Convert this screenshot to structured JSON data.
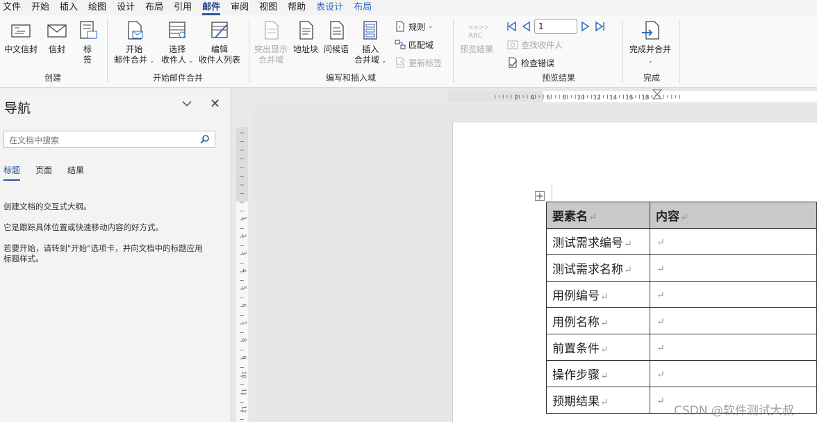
{
  "menu": {
    "items": [
      "文件",
      "开始",
      "插入",
      "绘图",
      "设计",
      "布局",
      "引用",
      "邮件",
      "审阅",
      "视图",
      "帮助",
      "表设计",
      "布局"
    ],
    "active_index": 7,
    "contextual_indices": [
      11,
      12
    ]
  },
  "ribbon": {
    "create_group": {
      "title": "创建",
      "envelopes": "中文信封",
      "envelope": "信封",
      "labels_line1": "标",
      "labels_line2": "签"
    },
    "start_merge_group": {
      "title": "开始邮件合并",
      "start_line1": "开始",
      "start_line2": "邮件合并",
      "select_line1": "选择",
      "select_line2": "收件人",
      "edit_line1": "编辑",
      "edit_line2": "收件人列表"
    },
    "write_insert_group": {
      "title": "编写和插入域",
      "highlight_line1": "突出显示",
      "highlight_line2": "合并域",
      "address_block": "地址块",
      "greeting_line": "问候语",
      "insert_line1": "插入",
      "insert_line2": "合并域",
      "rules": "规则",
      "match_fields": "匹配域",
      "update_labels": "更新标签"
    },
    "preview_group": {
      "title": "预览结果",
      "preview_results": "预览结果",
      "record_number": "1",
      "find_recipient": "查找收件人",
      "check_errors": "检查错误",
      "abc_icon_text": "ABC"
    },
    "finish_group": {
      "title": "完成",
      "finish_merge": "完成并合并"
    }
  },
  "nav": {
    "title": "导航",
    "search_placeholder": "在文档中搜索",
    "tabs": [
      "标题",
      "页面",
      "结果"
    ],
    "line1": "创建文档的交互式大纲。",
    "line2": "它是跟踪具体位置或快速移动内容的好方式。",
    "line3a": "若要开始，请转到\"开始\"选项卡，并向文档中的标题应用",
    "line3b": "标题样式。"
  },
  "ruler": {
    "h_labels": [
      "2",
      "4",
      "6",
      "8",
      "10",
      "12",
      "14",
      "16",
      "18"
    ],
    "v_labels": [
      "1",
      "2",
      "3",
      "4",
      "5",
      "6",
      "7",
      "8",
      "9",
      "10",
      "11",
      "12"
    ]
  },
  "table": {
    "header": [
      "要素名",
      "内容"
    ],
    "rows": [
      "测试需求编号",
      "测试需求名称",
      "用例编号",
      "用例名称",
      "前置条件",
      "操作步骤",
      "预期结果"
    ],
    "paragraph_mark": "↵"
  },
  "watermark": "CSDN @软件测试大叔",
  "colors": {
    "accent": "#2b579a",
    "contextual_tab": "#2b6cc4",
    "table_header_bg": "#c9c9c9"
  }
}
